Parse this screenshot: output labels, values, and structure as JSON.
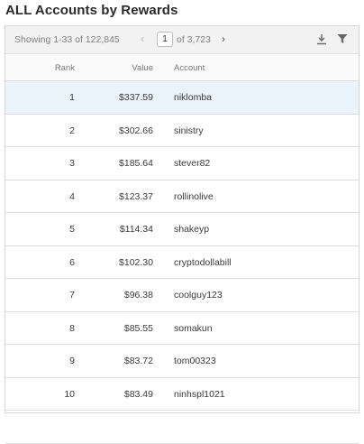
{
  "title": "ALL Accounts by Rewards",
  "toolbar": {
    "showing": "Showing 1-33 of 122,845",
    "prev": "‹",
    "page": "1",
    "of_total": "of 3,723",
    "next": "›"
  },
  "columns": {
    "rank": "Rank",
    "value": "Value",
    "account": "Account"
  },
  "rows": [
    {
      "rank": "1",
      "value": "$337.59",
      "account": "niklomba"
    },
    {
      "rank": "2",
      "value": "$302.66",
      "account": "sinistry"
    },
    {
      "rank": "3",
      "value": "$185.64",
      "account": "stever82"
    },
    {
      "rank": "4",
      "value": "$123.37",
      "account": "rollinolive"
    },
    {
      "rank": "5",
      "value": "$114.34",
      "account": "shakeyp"
    },
    {
      "rank": "6",
      "value": "$102.30",
      "account": "cryptodollabill"
    },
    {
      "rank": "7",
      "value": "$96.38",
      "account": "coolguy123"
    },
    {
      "rank": "8",
      "value": "$85.55",
      "account": "somakun"
    },
    {
      "rank": "9",
      "value": "$83.72",
      "account": "tom00323"
    },
    {
      "rank": "10",
      "value": "$83.49",
      "account": "ninhspl1021"
    },
    {
      "rank": "",
      "value": "",
      "account": ""
    }
  ],
  "selected_row_rank": "1",
  "icons": {
    "download": "download-icon",
    "filter": "filter-icon"
  },
  "colors": {
    "selected_row": "#eaf2fb",
    "toolbar_bg": "#f2f2f2"
  }
}
